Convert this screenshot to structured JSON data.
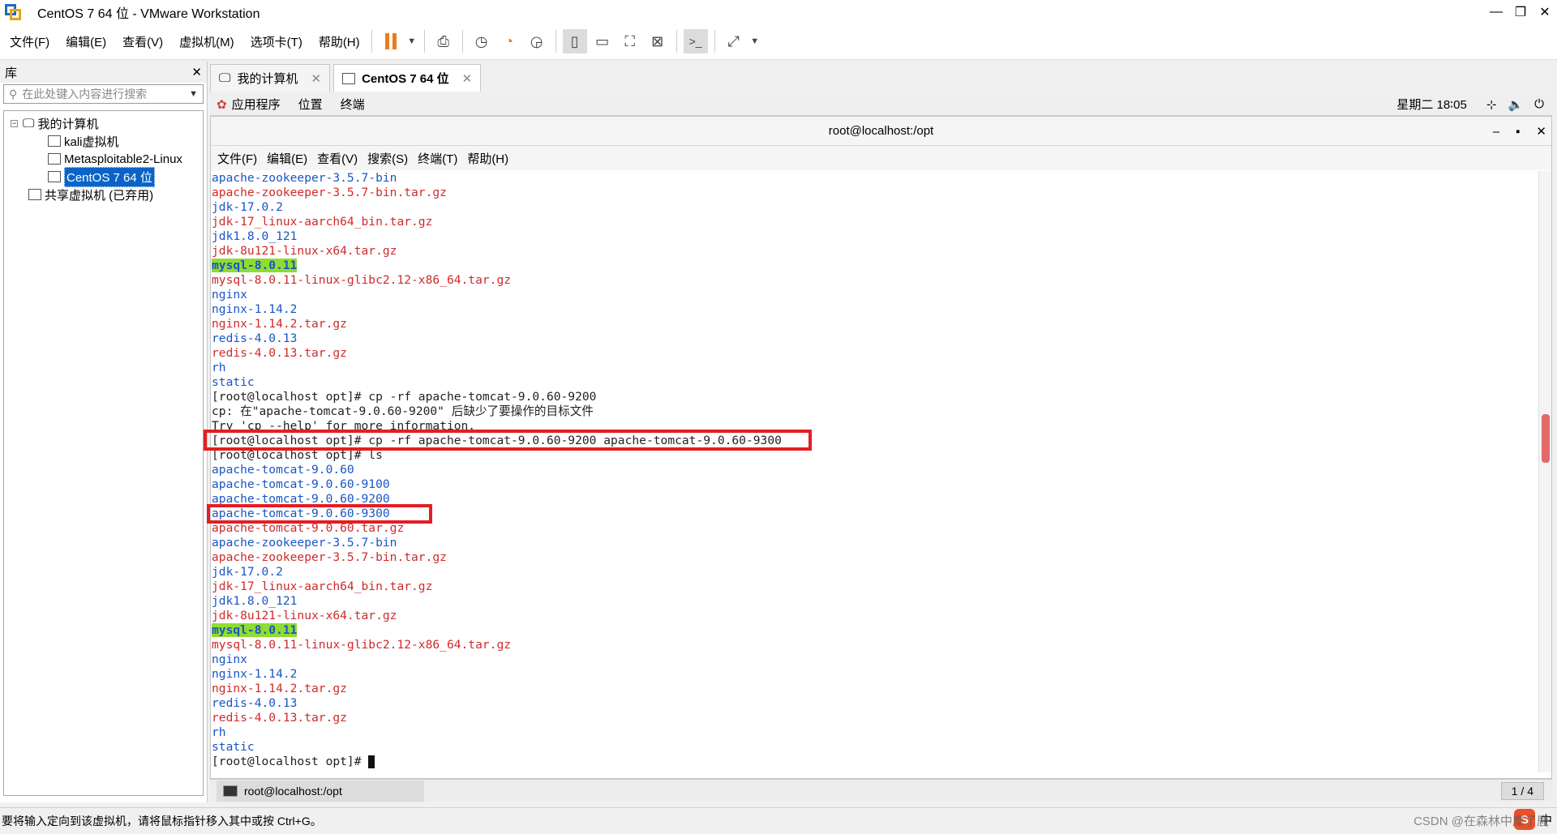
{
  "window": {
    "title": "CentOS 7 64 位 - VMware Workstation"
  },
  "menu": [
    "文件(F)",
    "编辑(E)",
    "查看(V)",
    "虚拟机(M)",
    "选项卡(T)",
    "帮助(H)"
  ],
  "library": {
    "title": "库",
    "search_placeholder": "在此处键入内容进行搜索",
    "tree": {
      "root": "我的计算机",
      "items": [
        "kali虚拟机",
        "Metasploitable2-Linux",
        "CentOS 7 64 位"
      ],
      "shared": "共享虚拟机 (已弃用)"
    }
  },
  "tabs": [
    {
      "label": "我的计算机"
    },
    {
      "label": "CentOS 7 64 位"
    }
  ],
  "gnome": {
    "apps": "应用程序",
    "places": "位置",
    "terminal": "终端",
    "clock": "星期二 18∶05"
  },
  "terminal": {
    "title": "root@localhost:/opt",
    "menu": [
      "文件(F)",
      "编辑(E)",
      "查看(V)",
      "搜索(S)",
      "终端(T)",
      "帮助(H)"
    ],
    "lines": [
      {
        "t": "apache-zookeeper-3.5.7-bin",
        "c": "blue"
      },
      {
        "t": "apache-zookeeper-3.5.7-bin.tar.gz",
        "c": "red"
      },
      {
        "t": "jdk-17.0.2",
        "c": "blue"
      },
      {
        "t": "jdk-17_linux-aarch64_bin.tar.gz",
        "c": "red"
      },
      {
        "t": "jdk1.8.0_121",
        "c": "blue"
      },
      {
        "t": "jdk-8u121-linux-x64.tar.gz",
        "c": "red"
      },
      {
        "t": "mysql-8.0.11",
        "c": "hl"
      },
      {
        "t": "mysql-8.0.11-linux-glibc2.12-x86_64.tar.gz",
        "c": "red"
      },
      {
        "t": "nginx",
        "c": "blue"
      },
      {
        "t": "nginx-1.14.2",
        "c": "blue"
      },
      {
        "t": "nginx-1.14.2.tar.gz",
        "c": "red"
      },
      {
        "t": "redis-4.0.13",
        "c": "blue"
      },
      {
        "t": "redis-4.0.13.tar.gz",
        "c": "red"
      },
      {
        "t": "rh",
        "c": "blue"
      },
      {
        "t": "static",
        "c": "blue"
      },
      {
        "t": "[root@localhost opt]# cp -rf apache-tomcat-9.0.60-9200",
        "c": "dark"
      },
      {
        "t": "cp: 在\"apache-tomcat-9.0.60-9200\" 后缺少了要操作的目标文件",
        "c": "dark"
      },
      {
        "t": "Try 'cp --help' for more information.",
        "c": "dark"
      },
      {
        "t": "[root@localhost opt]# cp -rf apache-tomcat-9.0.60-9200 apache-tomcat-9.0.60-9300",
        "c": "dark"
      },
      {
        "t": "[root@localhost opt]# ls",
        "c": "dark"
      },
      {
        "t": "apache-tomcat-9.0.60",
        "c": "blue"
      },
      {
        "t": "apache-tomcat-9.0.60-9100",
        "c": "blue"
      },
      {
        "t": "apache-tomcat-9.0.60-9200",
        "c": "blue"
      },
      {
        "t": "apache-tomcat-9.0.60-9300",
        "c": "blue"
      },
      {
        "t": "apache-tomcat-9.0.60.tar.gz",
        "c": "red"
      },
      {
        "t": "apache-zookeeper-3.5.7-bin",
        "c": "blue"
      },
      {
        "t": "apache-zookeeper-3.5.7-bin.tar.gz",
        "c": "red"
      },
      {
        "t": "jdk-17.0.2",
        "c": "blue"
      },
      {
        "t": "jdk-17_linux-aarch64_bin.tar.gz",
        "c": "red"
      },
      {
        "t": "jdk1.8.0_121",
        "c": "blue"
      },
      {
        "t": "jdk-8u121-linux-x64.tar.gz",
        "c": "red"
      },
      {
        "t": "mysql-8.0.11",
        "c": "hl"
      },
      {
        "t": "mysql-8.0.11-linux-glibc2.12-x86_64.tar.gz",
        "c": "red"
      },
      {
        "t": "nginx",
        "c": "blue"
      },
      {
        "t": "nginx-1.14.2",
        "c": "blue"
      },
      {
        "t": "nginx-1.14.2.tar.gz",
        "c": "red"
      },
      {
        "t": "redis-4.0.13",
        "c": "blue"
      },
      {
        "t": "redis-4.0.13.tar.gz",
        "c": "red"
      },
      {
        "t": "rh",
        "c": "blue"
      },
      {
        "t": "static",
        "c": "blue"
      },
      {
        "t": "[root@localhost opt]# ",
        "c": "dark",
        "cursor": true
      }
    ]
  },
  "vm_taskbar": {
    "task": "root@localhost:/opt",
    "page": "1 / 4"
  },
  "status": {
    "message": "要将输入定向到该虚拟机，请将鼠标指针移入其中或按 Ctrl+G。"
  },
  "tray": {
    "ime": "中"
  },
  "watermark": "CSDN @在森林中麋了鹿"
}
